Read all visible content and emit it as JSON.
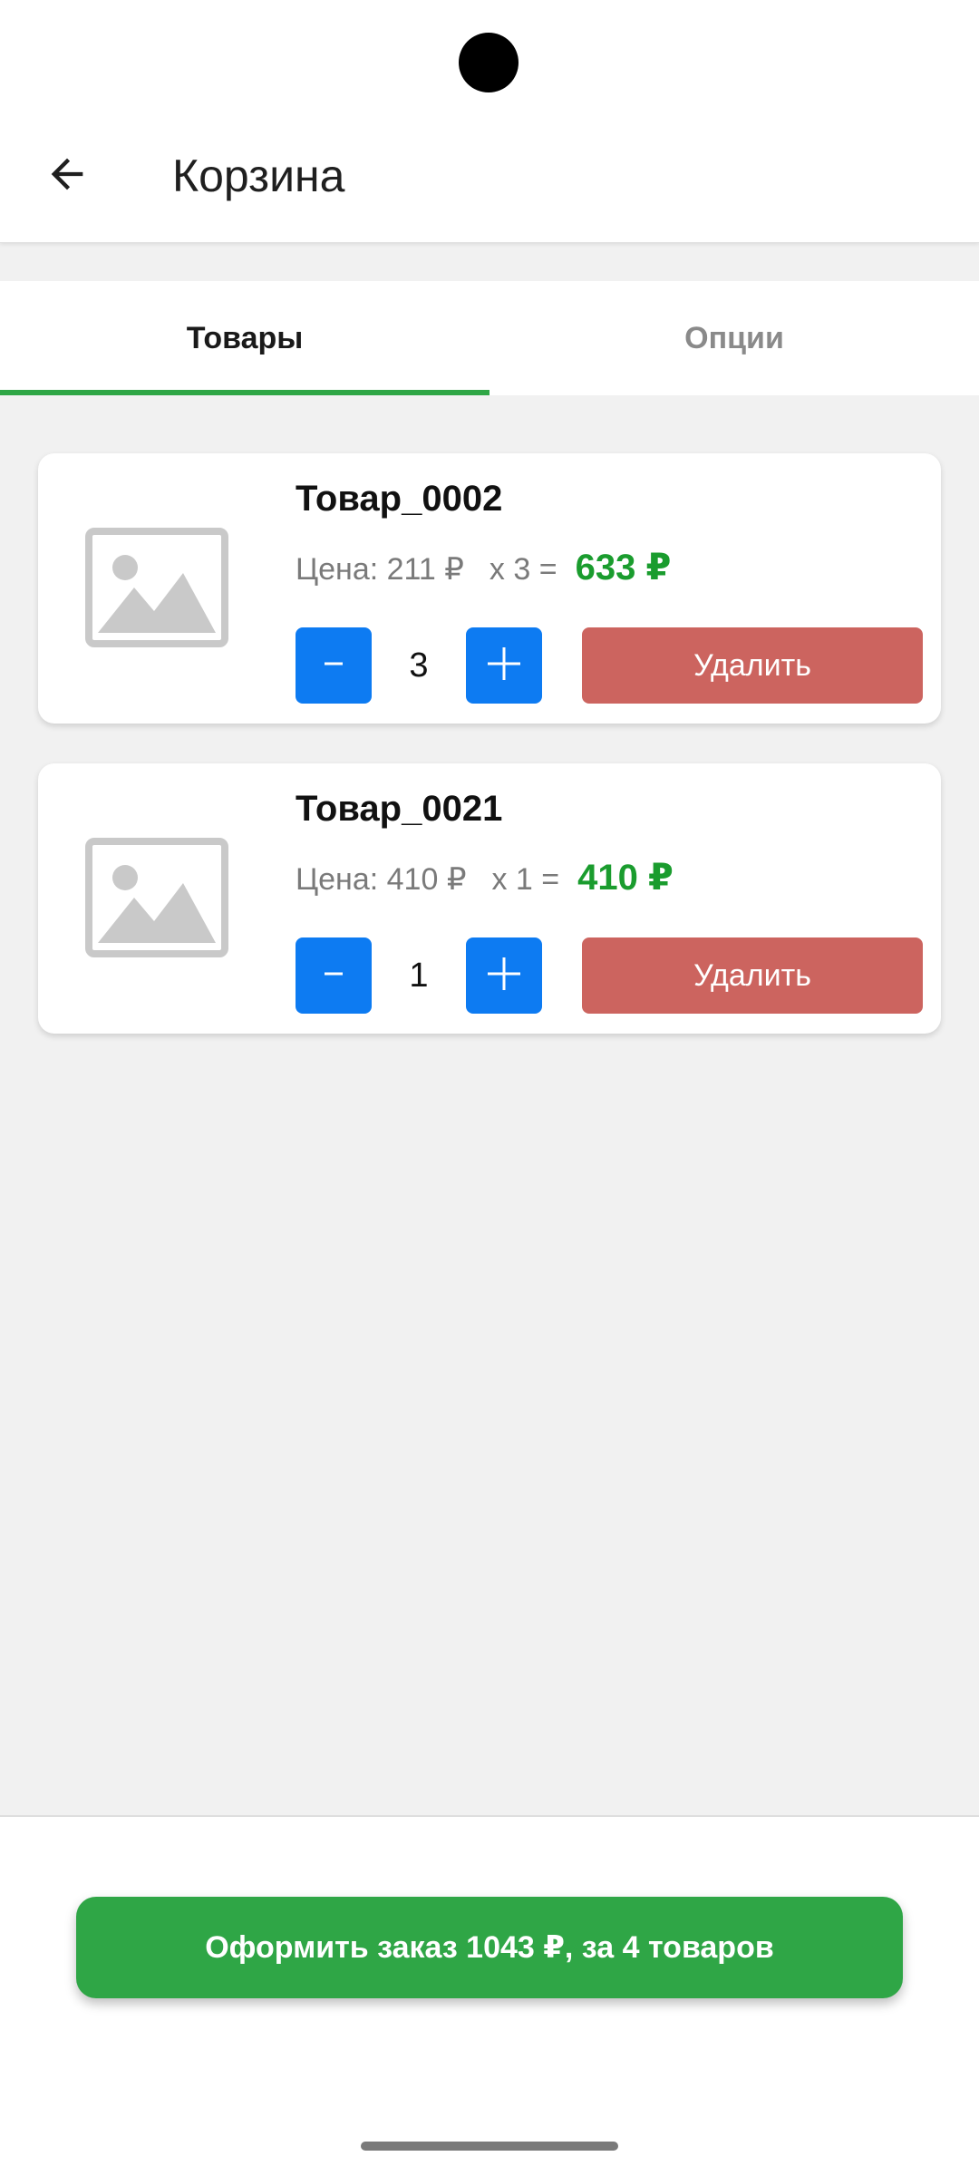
{
  "header": {
    "title": "Корзина",
    "back_icon": "arrow-left-icon"
  },
  "tabs": [
    {
      "label": "Товары",
      "active": true
    },
    {
      "label": "Опции",
      "active": false
    }
  ],
  "cart": {
    "remove_label": "Удалить",
    "items": [
      {
        "name": "Товар_0002",
        "price_text": "Цена: 211 ₽",
        "qty_text": "x 3 =",
        "total_text": "633 ₽",
        "quantity": "3",
        "image_icon": "image-placeholder-icon"
      },
      {
        "name": "Товар_0021",
        "price_text": "Цена: 410 ₽",
        "qty_text": "x 1 =",
        "total_text": "410 ₽",
        "quantity": "1",
        "image_icon": "image-placeholder-icon"
      }
    ]
  },
  "checkout": {
    "label": "Оформить заказ 1043 ₽, за 4 товаров"
  },
  "colors": {
    "accent_green": "#2fa646",
    "price_green": "#1a9c2e",
    "stepper_blue": "#0d7bf2",
    "delete_red": "#cc645f"
  }
}
